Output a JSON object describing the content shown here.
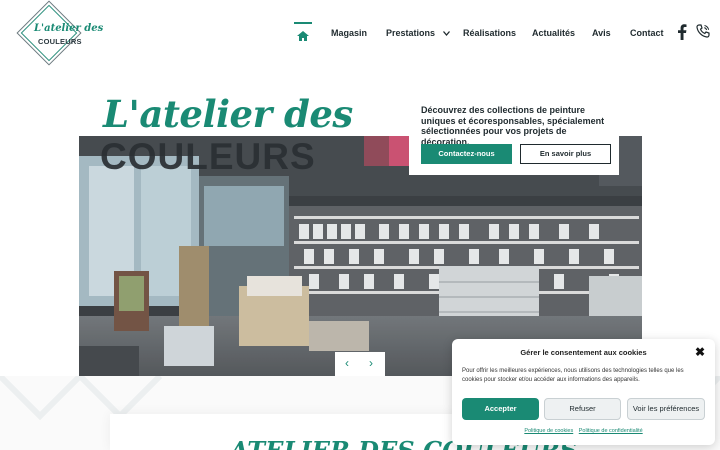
{
  "brand": {
    "logo_line1": "L'atelier des",
    "logo_line2": "COULEURS"
  },
  "nav": {
    "items": [
      "Magasin",
      "Prestations",
      "Réalisations",
      "Actualités",
      "Avis",
      "Contact"
    ]
  },
  "hero": {
    "title_line1": "L'atelier des",
    "title_line2": "COULEURS",
    "description": "Découvrez des collections de peinture uniques et écoresponsables, spécialement sélectionnées pour vos projets de décoration.",
    "primary_button": "Contactez-nous",
    "secondary_button": "En savoir plus",
    "prev_arrow": "‹",
    "next_arrow": "›"
  },
  "section": {
    "title": "ATELIER DES COULEURS"
  },
  "cookie": {
    "title": "Gérer le consentement aux cookies",
    "close": "✖",
    "message": "Pour offrir les meilleures expériences, nous utilisons des technologies telles que les cookies pour stocker et/ou accéder aux informations des appareils.",
    "accept": "Accepter",
    "refuse": "Refuser",
    "preferences": "Voir les préférences",
    "link_cookies": "Politique de cookies",
    "link_privacy": "Politique de confidentialité"
  },
  "colors": {
    "accent": "#1a8a74",
    "text": "#1f2a2e"
  }
}
